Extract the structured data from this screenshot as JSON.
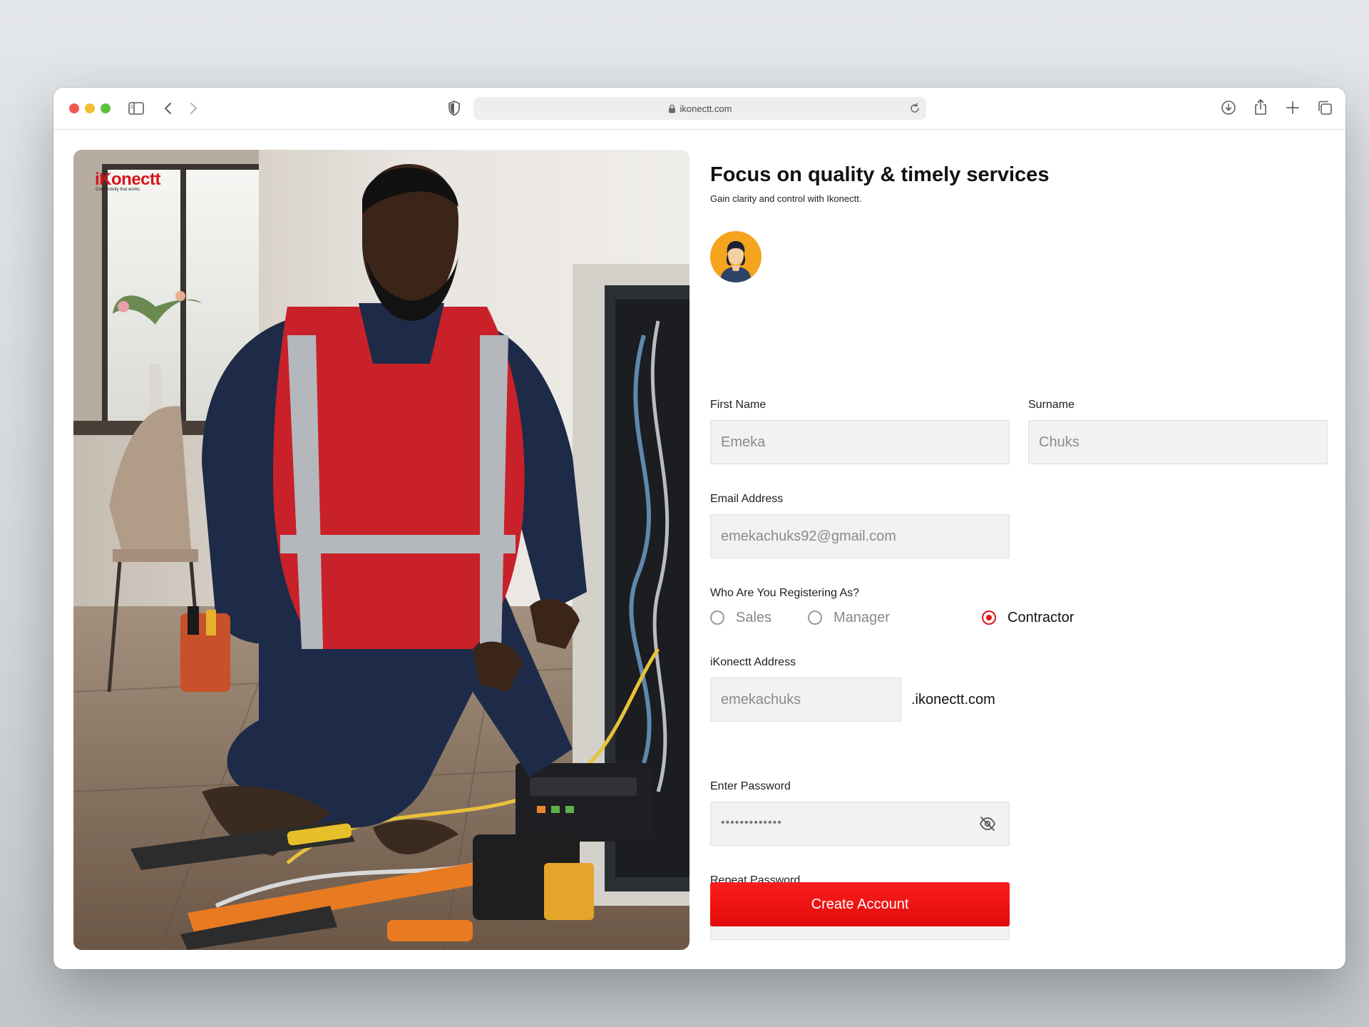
{
  "browser": {
    "url": "ikonectt.com",
    "traffic_colors": [
      "#ee5a52",
      "#f5bd2e",
      "#5fc23e"
    ]
  },
  "brand": {
    "name": "iKonectt",
    "tagline": "Connectivity that works.",
    "color": "#d7141b"
  },
  "header": {
    "title": "Focus on quality & timely services",
    "subtitle": "Gain clarity and control with Ikonectt."
  },
  "form": {
    "first_name": {
      "label": "First Name",
      "value": "Emeka"
    },
    "surname": {
      "label": "Surname",
      "value": "Chuks"
    },
    "email": {
      "label": "Email Address",
      "value": "emekachuks92@gmail.com"
    },
    "role": {
      "label": "Who Are You Registering As?",
      "options": [
        "Sales",
        "Manager",
        "Contractor"
      ],
      "selected": "Contractor"
    },
    "address": {
      "label": "iKonectt Address",
      "value": "emekachuks",
      "suffix": ".ikonectt.com"
    },
    "password": {
      "label": "Enter Password",
      "mask": "•••••••••••••"
    },
    "repeat_password": {
      "label": "Repeat Password",
      "mask": "•••••••••••••"
    },
    "submit_label": "Create Account"
  },
  "accent": "#e0141a"
}
